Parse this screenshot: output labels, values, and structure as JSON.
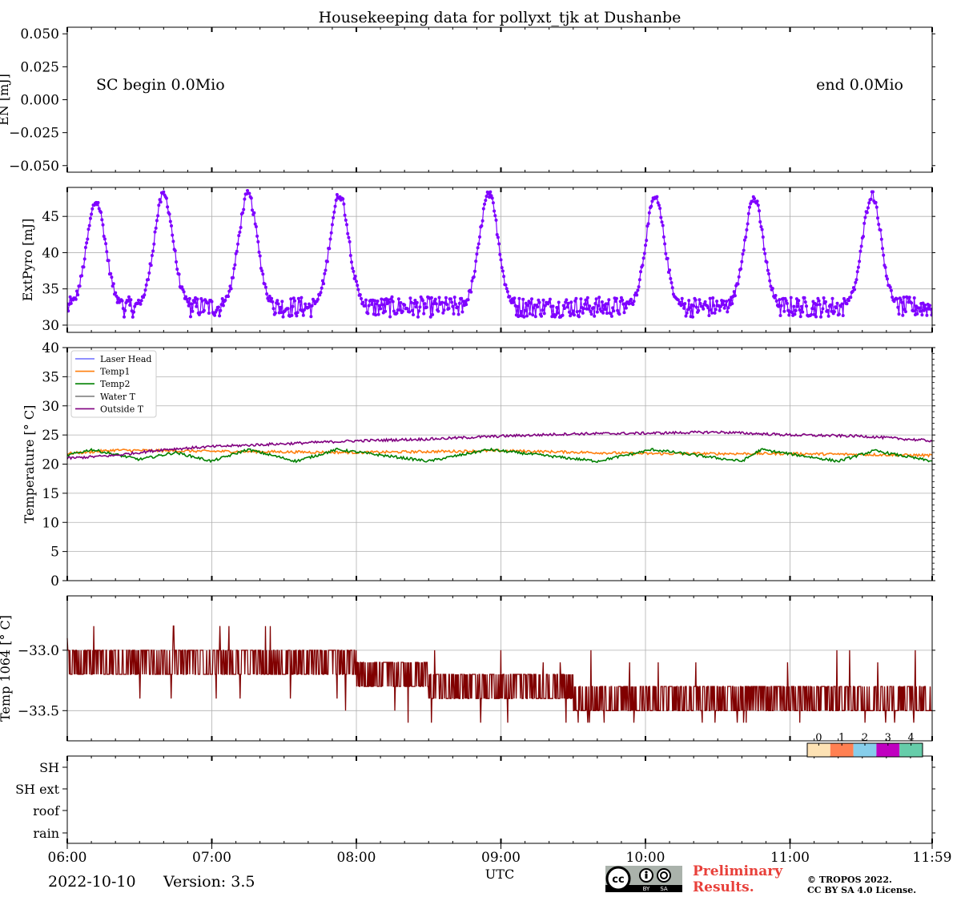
{
  "page": {
    "title": "Housekeeping data for pollyxt_tjk at Dushanbe",
    "date": "2022-10-10",
    "version": "Version: 3.5",
    "prelim_line1": "Preliminary",
    "prelim_line2": "Results.",
    "copyright_line1": "© TROPOS 2022.",
    "copyright_line2": "CC BY SA 4.0 License.",
    "cc_badge": [
      "BY",
      "SA"
    ]
  },
  "chart_data": [
    {
      "type": "line",
      "id": "en",
      "ylabel": "EN [mJ]",
      "ylim": [
        -0.055,
        0.055
      ],
      "yticks": [
        -0.05,
        -0.025,
        0.0,
        0.025,
        0.05
      ],
      "ytick_labels": [
        "−0.050",
        "−0.025",
        "0.000",
        "0.025",
        "0.050"
      ],
      "grid": false,
      "annotations": [
        "SC begin 0.0Mio",
        "end 0.0Mio"
      ],
      "series": []
    },
    {
      "type": "line",
      "id": "extpyro",
      "ylabel": "ExtPyro [mJ]",
      "ylim": [
        29,
        49
      ],
      "yticks": [
        30,
        35,
        40,
        45
      ],
      "ytick_labels": [
        "30",
        "35",
        "40",
        "45"
      ],
      "grid": true,
      "color": "#7f00ff",
      "baseline": 32.5,
      "peaks": [
        {
          "time": "06:12",
          "value": 47.0
        },
        {
          "time": "06:40",
          "value": 48.0
        },
        {
          "time": "07:15",
          "value": 48.0
        },
        {
          "time": "07:53",
          "value": 48.0
        },
        {
          "time": "08:55",
          "value": 48.0
        },
        {
          "time": "10:04",
          "value": 47.5
        },
        {
          "time": "10:45",
          "value": 47.5
        },
        {
          "time": "11:34",
          "value": 48.0
        }
      ]
    },
    {
      "type": "line",
      "id": "temperature",
      "ylabel": "Temperature [$^\\circ C$]",
      "ylim": [
        0,
        40
      ],
      "yticks": [
        0,
        5,
        10,
        15,
        20,
        25,
        30,
        35,
        40
      ],
      "ytick_labels": [
        "0",
        "5",
        "10",
        "15",
        "20",
        "25",
        "30",
        "35",
        "40"
      ],
      "grid": true,
      "legend_position": "top-left",
      "series": [
        {
          "name": "Laser Head",
          "color": "#6b6bff",
          "values": []
        },
        {
          "name": "Temp1",
          "color": "#ff7f0e",
          "points": [
            [
              "06:00",
              21.8
            ],
            [
              "06:20",
              22.4
            ],
            [
              "07:00",
              22.2
            ],
            [
              "08:00",
              22.0
            ],
            [
              "09:00",
              22.3
            ],
            [
              "10:00",
              21.8
            ],
            [
              "11:00",
              21.8
            ],
            [
              "11:59",
              21.5
            ]
          ]
        },
        {
          "name": "Temp2",
          "color": "#008000",
          "points": [
            [
              "06:00",
              21.5
            ],
            [
              "06:10",
              22.5
            ],
            [
              "06:30",
              20.8
            ],
            [
              "06:45",
              22.0
            ],
            [
              "07:00",
              20.5
            ],
            [
              "07:15",
              22.5
            ],
            [
              "07:35",
              20.5
            ],
            [
              "07:52",
              22.5
            ],
            [
              "08:30",
              20.5
            ],
            [
              "08:55",
              22.5
            ],
            [
              "09:40",
              20.5
            ],
            [
              "10:03",
              22.5
            ],
            [
              "10:40",
              20.5
            ],
            [
              "10:48",
              22.5
            ],
            [
              "11:20",
              20.5
            ],
            [
              "11:35",
              22.3
            ],
            [
              "11:59",
              20.5
            ]
          ]
        },
        {
          "name": "Water T",
          "color": "#808080",
          "values": []
        },
        {
          "name": "Outside T",
          "color": "#800080",
          "points": [
            [
              "06:00",
              21.0
            ],
            [
              "06:20",
              21.5
            ],
            [
              "06:40",
              22.5
            ],
            [
              "07:00",
              23.0
            ],
            [
              "07:30",
              23.5
            ],
            [
              "08:00",
              24.0
            ],
            [
              "08:30",
              24.3
            ],
            [
              "09:00",
              24.8
            ],
            [
              "09:30",
              25.2
            ],
            [
              "10:00",
              25.3
            ],
            [
              "10:30",
              25.5
            ],
            [
              "11:00",
              25.0
            ],
            [
              "11:30",
              24.8
            ],
            [
              "11:59",
              24.0
            ]
          ]
        }
      ]
    },
    {
      "type": "line",
      "id": "temp1064",
      "ylabel": "Temp 1064 [$^\\circ C$]",
      "ylim": [
        -33.75,
        -32.55
      ],
      "yticks": [
        -33.5,
        -33.0
      ],
      "ytick_labels": [
        "−33.5",
        "−33.0"
      ],
      "grid": true,
      "color": "#800000",
      "levels": [
        -32.8,
        -32.9,
        -33.0,
        -33.1,
        -33.2,
        -33.3,
        -33.4,
        -33.5,
        -33.6
      ],
      "trend": [
        [
          "06:00",
          -33.05
        ],
        [
          "07:00",
          -33.1
        ],
        [
          "08:00",
          -33.15
        ],
        [
          "08:45",
          -33.3
        ],
        [
          "09:00",
          -33.3
        ],
        [
          "10:00",
          -33.4
        ],
        [
          "11:00",
          -33.4
        ],
        [
          "11:59",
          -33.4
        ]
      ]
    },
    {
      "type": "heatmap",
      "id": "flags",
      "categories": [
        "SH",
        "SH ext",
        "roof",
        "rain"
      ],
      "colorbar": {
        "ticks": [
          "0",
          "1",
          "2",
          "3",
          "4"
        ],
        "colors": [
          "#fde2b4",
          "#ff8052",
          "#87ceeb",
          "#c000c0",
          "#66cdaa"
        ]
      }
    }
  ],
  "x_axis": {
    "label": "UTC",
    "tick_labels": [
      "06:00",
      "07:00",
      "08:00",
      "09:00",
      "10:00",
      "11:00",
      "11:59"
    ],
    "start": "06:00",
    "end": "11:59"
  }
}
